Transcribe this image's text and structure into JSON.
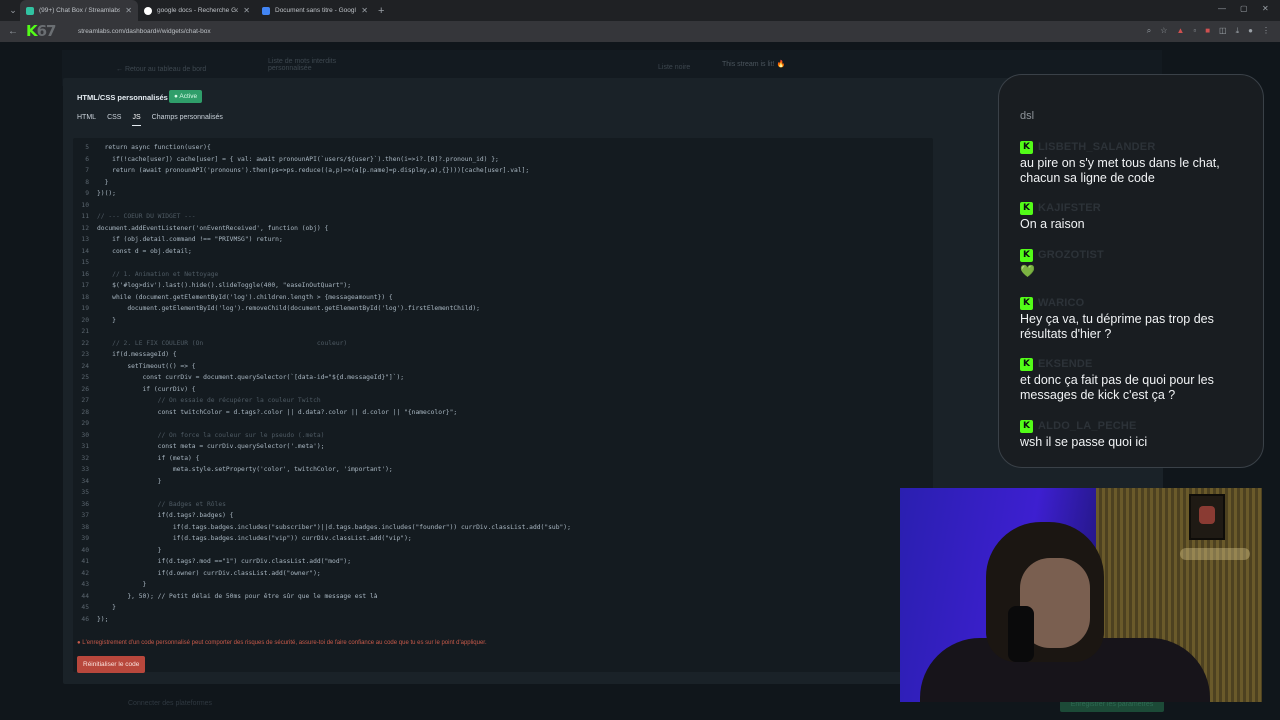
{
  "browser": {
    "tabs": [
      {
        "title": "(99+) Chat Box / Streamlabs",
        "favicon_color": "#31c3a2",
        "active": true
      },
      {
        "title": "google docs - Recherche Google",
        "favicon_color": "#ffffff",
        "active": false
      },
      {
        "title": "Document sans titre - Google Docs",
        "favicon_color": "#4285f4",
        "active": false
      }
    ],
    "url": "streamlabs.com/dashboard#/widgets/chat-box",
    "logo_text": "67"
  },
  "page": {
    "back_link": "← Retour au tableau de bord",
    "top_label_1": "Liste de mots interdits personnalisée",
    "top_label_2": "Liste noire",
    "top_label_3": "This stream is lit! 🔥",
    "panel_title": "HTML/CSS personnalisés",
    "status_badge": "● Active",
    "subtabs": [
      "HTML",
      "CSS",
      "JS",
      "Champs personnalisés"
    ],
    "warning": "● L'enregistrement d'un code personnalisé peut comporter des risques de sécurité, assure-toi de faire confiance au code que tu es sur le point d'appliquer.",
    "reset_button": "Réinitialiser le code",
    "footer_link": "Connecter des plateformes",
    "save_button": "Enregistrer les paramètres"
  },
  "code_lines": [
    {
      "n": "5",
      "t": "  return async function(user){"
    },
    {
      "n": "6",
      "t": "    if(!cache[user]) cache[user] = { val: await pronounAPI(`users/${user}`).then(i=>i?.[0]?.pronoun_id) };"
    },
    {
      "n": "7",
      "t": "    return (await pronounAPI('pronouns').then(ps=>ps.reduce((a,p)=>(a[p.name]=p.display,a),{})))[cache[user].val];"
    },
    {
      "n": "8",
      "t": "  }"
    },
    {
      "n": "9",
      "t": "})();"
    },
    {
      "n": "10",
      "t": ""
    },
    {
      "n": "11",
      "t": "// --- COEUR DU WIDGET ---"
    },
    {
      "n": "12",
      "t": "document.addEventListener('onEventReceived', function (obj) {"
    },
    {
      "n": "13",
      "t": "    if (obj.detail.command !== \"PRIVMSG\") return;"
    },
    {
      "n": "14",
      "t": "    const d = obj.detail;"
    },
    {
      "n": "15",
      "t": ""
    },
    {
      "n": "16",
      "t": "    // 1. Animation et Nettoyage"
    },
    {
      "n": "17",
      "t": "    $('#log>div').last().hide().slideToggle(400, \"easeInOutQuart\");"
    },
    {
      "n": "18",
      "t": "    while (document.getElementById('log').children.length > {messageamount}) {"
    },
    {
      "n": "19",
      "t": "        document.getElementById('log').removeChild(document.getElementById('log').firstElementChild);"
    },
    {
      "n": "20",
      "t": "    }"
    },
    {
      "n": "21",
      "t": ""
    },
    {
      "n": "22",
      "t": "    // 2. LE FIX COULEUR (On                              couleur)"
    },
    {
      "n": "23",
      "t": "    if(d.messageId) {"
    },
    {
      "n": "24",
      "t": "        setTimeout(() => {"
    },
    {
      "n": "25",
      "t": "            const currDiv = document.querySelector(`[data-id=\"${d.messageId}\"]`);"
    },
    {
      "n": "26",
      "t": "            if (currDiv) {"
    },
    {
      "n": "27",
      "t": "                // On essaie de récupérer la couleur Twitch"
    },
    {
      "n": "28",
      "t": "                const twitchColor = d.tags?.color || d.data?.color || d.color || \"{namecolor}\";"
    },
    {
      "n": "29",
      "t": ""
    },
    {
      "n": "30",
      "t": "                // On force la couleur sur le pseudo (.meta)"
    },
    {
      "n": "31",
      "t": "                const meta = currDiv.querySelector('.meta');"
    },
    {
      "n": "32",
      "t": "                if (meta) {"
    },
    {
      "n": "33",
      "t": "                    meta.style.setProperty('color', twitchColor, 'important');"
    },
    {
      "n": "34",
      "t": "                }"
    },
    {
      "n": "35",
      "t": ""
    },
    {
      "n": "36",
      "t": "                // Badges et Rôles"
    },
    {
      "n": "37",
      "t": "                if(d.tags?.badges) {"
    },
    {
      "n": "38",
      "t": "                    if(d.tags.badges.includes(\"subscriber\")||d.tags.badges.includes(\"founder\")) currDiv.classList.add(\"sub\");"
    },
    {
      "n": "39",
      "t": "                    if(d.tags.badges.includes(\"vip\")) currDiv.classList.add(\"vip\");"
    },
    {
      "n": "40",
      "t": "                }"
    },
    {
      "n": "41",
      "t": "                if(d.tags?.mod ==\"1\") currDiv.classList.add(\"mod\");"
    },
    {
      "n": "42",
      "t": "                if(d.owner) currDiv.classList.add(\"owner\");"
    },
    {
      "n": "43",
      "t": "            }"
    },
    {
      "n": "44",
      "t": "        }, 50); // Petit délai de 50ms pour être sûr que le message est là"
    },
    {
      "n": "45",
      "t": "    }"
    },
    {
      "n": "46",
      "t": "});"
    }
  ],
  "chat": {
    "first_line": "dsl",
    "messages": [
      {
        "user": "LISBETH_SALANDER",
        "text": "au pire on s'y met tous dans le chat, chacun sa ligne de code"
      },
      {
        "user": "KAJIFSTER",
        "text": "On a raison"
      },
      {
        "user": "GROZOTIST",
        "text": "💚"
      },
      {
        "user": "WARICO",
        "text": "Hey ça va, tu déprime pas trop des résultats d'hier ?"
      },
      {
        "user": "EKSENDE",
        "text": "et donc ça fait pas de quoi pour les messages de kick c'est ça ?"
      },
      {
        "user": "ALDO_LA_PECHE",
        "text": "wsh il se passe quoi ici"
      }
    ],
    "badge_letter": "K"
  },
  "colors": {
    "kick_green": "#53fc18",
    "active_badge": "#2f9e6a",
    "reset_red": "#b8473c"
  }
}
